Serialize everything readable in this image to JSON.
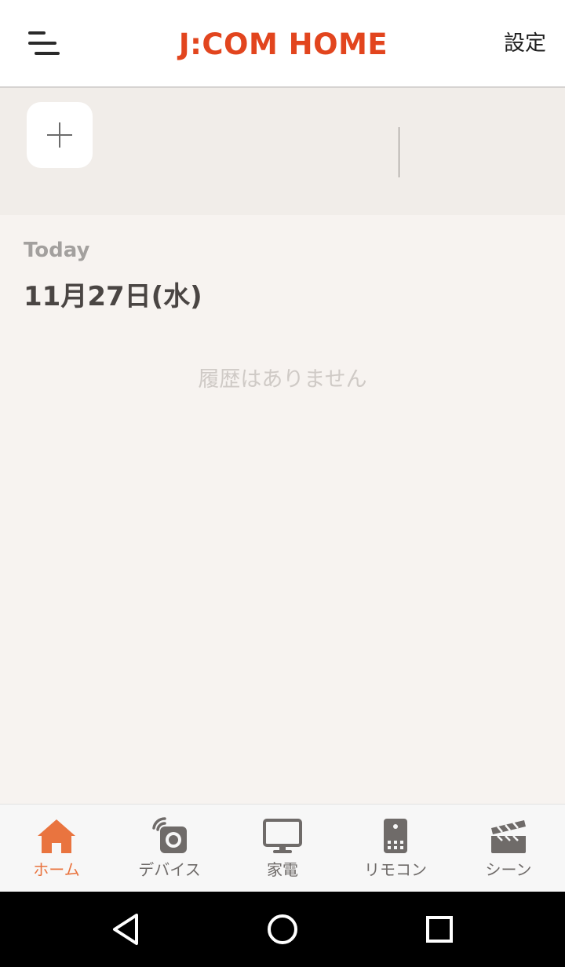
{
  "header": {
    "logo_text": "J:COM HOME",
    "settings_label": "設定",
    "menu_icon": "menu-icon"
  },
  "quick_actions": {
    "add_icon": "plus-icon"
  },
  "history": {
    "section_label": "Today",
    "date": "11月27日(水)",
    "empty_message": "履歴はありません"
  },
  "tabs": [
    {
      "label": "ホーム",
      "icon": "home-icon",
      "active": true
    },
    {
      "label": "デバイス",
      "icon": "device-icon",
      "active": false
    },
    {
      "label": "家電",
      "icon": "monitor-icon",
      "active": false
    },
    {
      "label": "リモコン",
      "icon": "remote-icon",
      "active": false
    },
    {
      "label": "シーン",
      "icon": "clapperboard-icon",
      "active": false
    }
  ],
  "system_nav": {
    "back_icon": "back-triangle-icon",
    "home_icon": "home-circle-icon",
    "recents_icon": "recents-square-icon"
  },
  "colors": {
    "accent": "#e9743f",
    "brand": "#e2451e",
    "tab_inactive": "#6f6b69"
  }
}
